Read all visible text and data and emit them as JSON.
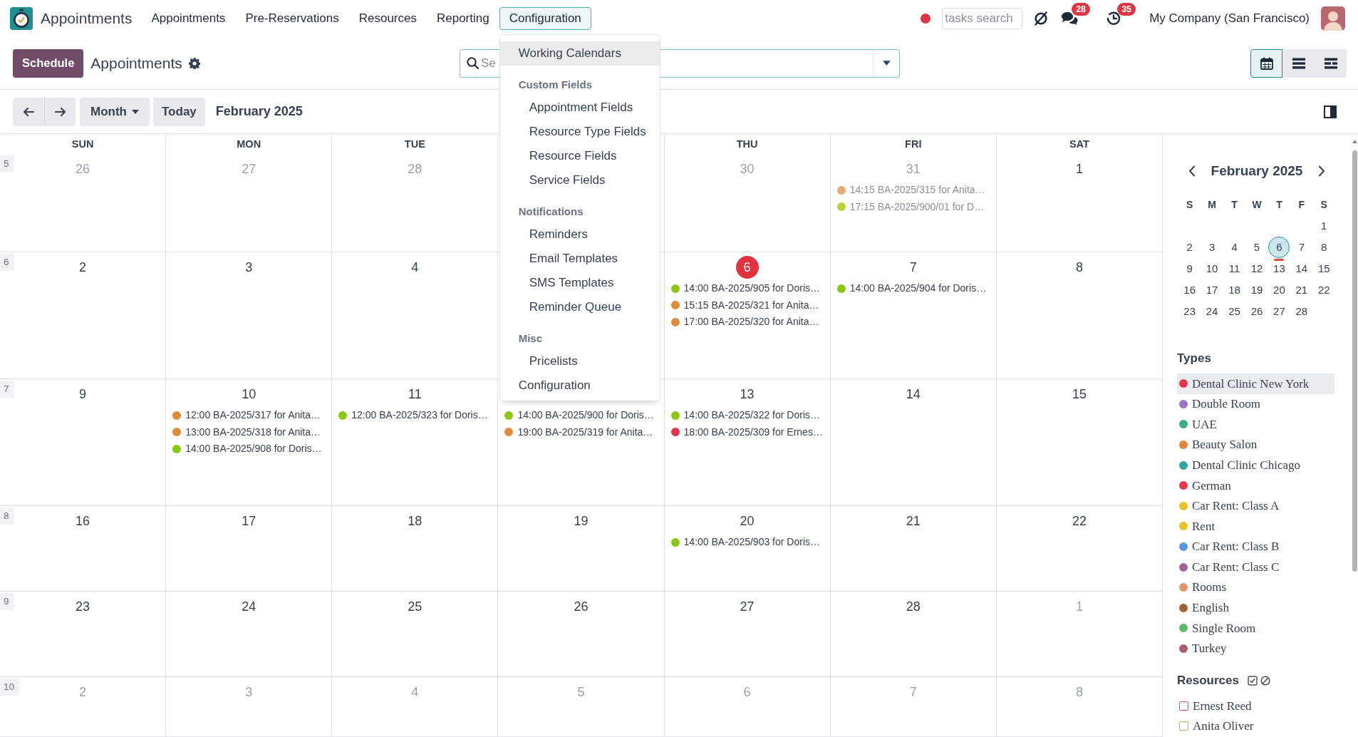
{
  "navbar": {
    "brand": "Appointments",
    "menu": [
      {
        "label": "Appointments",
        "selected": false
      },
      {
        "label": "Pre-Reservations",
        "selected": false
      },
      {
        "label": "Resources",
        "selected": false
      },
      {
        "label": "Reporting",
        "selected": false
      },
      {
        "label": "Configuration",
        "selected": true
      }
    ],
    "tasks_search": {
      "placeholder": "tasks search"
    },
    "messages_badge": "28",
    "activities_badge": "35",
    "company": "My Company (San Francisco)"
  },
  "control_panel": {
    "primary_button": "Schedule",
    "title": "Appointments",
    "search": {
      "placeholder": "Se"
    },
    "views": [
      {
        "kind": "calendar",
        "selected": true
      },
      {
        "kind": "list",
        "selected": false
      },
      {
        "kind": "gantt",
        "selected": false
      }
    ]
  },
  "toolbar": {
    "scale": "Month",
    "today_button": "Today",
    "period": "February 2025"
  },
  "configuration_menu": {
    "items": [
      {
        "kind": "item",
        "label": "Working Calendars",
        "highlighted": true
      },
      {
        "kind": "header",
        "label": "Custom Fields",
        "highlighted": false
      },
      {
        "kind": "subitem",
        "label": "Appointment Fields",
        "highlighted": false
      },
      {
        "kind": "subitem",
        "label": "Resource Type Fields",
        "highlighted": false
      },
      {
        "kind": "subitem",
        "label": "Resource Fields",
        "highlighted": false
      },
      {
        "kind": "subitem",
        "label": "Service Fields",
        "highlighted": false
      },
      {
        "kind": "header",
        "label": "Notifications",
        "highlighted": false
      },
      {
        "kind": "subitem",
        "label": "Reminders",
        "highlighted": false
      },
      {
        "kind": "subitem",
        "label": "Email Templates",
        "highlighted": false
      },
      {
        "kind": "subitem",
        "label": "SMS Templates",
        "highlighted": false
      },
      {
        "kind": "subitem",
        "label": "Reminder Queue",
        "highlighted": false
      },
      {
        "kind": "header",
        "label": "Misc",
        "highlighted": false
      },
      {
        "kind": "subitem",
        "label": "Pricelists",
        "highlighted": false
      },
      {
        "kind": "item",
        "label": "Configuration",
        "highlighted": false
      }
    ]
  },
  "calendar": {
    "weekdays": {
      "sun": "SUN",
      "mon": "MON",
      "tue": "TUE",
      "thu": "THU",
      "fri": "FRI",
      "sat": "SAT"
    },
    "weeks": [
      {
        "number": "5",
        "days": {
          "sun": {
            "date": "26",
            "muted": true,
            "today": false
          },
          "mon": {
            "date": "27",
            "muted": true,
            "today": false
          },
          "tue": {
            "date": "28",
            "muted": true,
            "today": false
          },
          "thu": {
            "date": "30",
            "muted": true,
            "today": false
          },
          "fri": {
            "date": "31",
            "muted": true,
            "today": false,
            "events": [
              {
                "text": "14:15 BA-2025/315 for Anita…",
                "color": "#e9a97b"
              },
              {
                "text": "17:15 BA-2025/900/01 for D…",
                "color": "#b3d43a"
              }
            ]
          },
          "sat": {
            "date": "1",
            "muted": false,
            "today": false
          }
        }
      },
      {
        "number": "6",
        "days": {
          "sun": {
            "date": "2",
            "muted": false,
            "today": false
          },
          "mon": {
            "date": "3",
            "muted": false,
            "today": false
          },
          "tue": {
            "date": "4",
            "muted": false,
            "today": false
          },
          "thu": {
            "date": "6",
            "muted": false,
            "today": true,
            "events": [
              {
                "text": "14:00 BA-2025/905 for Doris…",
                "color": "#8bc716"
              },
              {
                "text": "15:15 BA-2025/321 for Anita…",
                "color": "#e08a3b"
              },
              {
                "text": "17:00 BA-2025/320 for Anita…",
                "color": "#e08a3b"
              }
            ]
          },
          "fri": {
            "date": "7",
            "muted": false,
            "today": false,
            "events": [
              {
                "text": "14:00 BA-2025/904 for Doris…",
                "color": "#8bc716"
              }
            ]
          },
          "sat": {
            "date": "8",
            "muted": false,
            "today": false
          }
        }
      },
      {
        "number": "7",
        "days": {
          "sun": {
            "date": "9",
            "muted": false,
            "today": false
          },
          "mon": {
            "date": "10",
            "muted": false,
            "today": false,
            "events": [
              {
                "text": "12:00 BA-2025/317 for Anita…",
                "color": "#e08a3b"
              },
              {
                "text": "13:00 BA-2025/318 for Anita…",
                "color": "#e08a3b"
              },
              {
                "text": "14:00 BA-2025/908 for Doris…",
                "color": "#8bc716"
              }
            ]
          },
          "tue": {
            "date": "11",
            "muted": false,
            "today": false,
            "events": [
              {
                "text": "12:00 BA-2025/323 for Doris…",
                "color": "#8bc716"
              }
            ]
          },
          "wed": {
            "events": [
              {
                "text": "14:00 BA-2025/900 for Doris…",
                "color": "#8bc716"
              },
              {
                "text": "19:00 BA-2025/319 for Anita…",
                "color": "#e08a3b"
              }
            ]
          },
          "thu": {
            "date": "13",
            "muted": false,
            "today": false,
            "events": [
              {
                "text": "14:00 BA-2025/322 for Doris…",
                "color": "#8bc716"
              },
              {
                "text": "18:00 BA-2025/309 for Ernes…",
                "color": "#e03448"
              }
            ]
          },
          "fri": {
            "date": "14",
            "muted": false,
            "today": false
          },
          "sat": {
            "date": "15",
            "muted": false,
            "today": false
          }
        }
      },
      {
        "number": "8",
        "days": {
          "sun": {
            "date": "16",
            "muted": false,
            "today": false
          },
          "mon": {
            "date": "17",
            "muted": false,
            "today": false
          },
          "tue": {
            "date": "18",
            "muted": false,
            "today": false
          },
          "wed": {
            "date": "19",
            "muted": false,
            "today": false
          },
          "thu": {
            "date": "20",
            "muted": false,
            "today": false,
            "events": [
              {
                "text": "14:00 BA-2025/903 for Doris…",
                "color": "#8bc716"
              }
            ]
          },
          "fri": {
            "date": "21",
            "muted": false,
            "today": false
          },
          "sat": {
            "date": "22",
            "muted": false,
            "today": false
          }
        }
      },
      {
        "number": "9",
        "days": {
          "sun": {
            "date": "23",
            "muted": false,
            "today": false
          },
          "mon": {
            "date": "24",
            "muted": false,
            "today": false
          },
          "tue": {
            "date": "25",
            "muted": false,
            "today": false
          },
          "wed": {
            "date": "26",
            "muted": false,
            "today": false
          },
          "thu": {
            "date": "27",
            "muted": false,
            "today": false
          },
          "fri": {
            "date": "28",
            "muted": false,
            "today": false
          },
          "sat": {
            "date": "1",
            "muted": true,
            "today": false
          }
        }
      },
      {
        "number": "10",
        "days": {
          "sun": {
            "date": "2",
            "muted": true,
            "today": false
          },
          "mon": {
            "date": "3",
            "muted": true,
            "today": false
          },
          "tue": {
            "date": "4",
            "muted": true,
            "today": false
          },
          "wed": {
            "date": "5",
            "muted": true,
            "today": false
          },
          "thu": {
            "date": "6",
            "muted": true,
            "today": false
          },
          "fri": {
            "date": "7",
            "muted": true,
            "today": false
          },
          "sat": {
            "date": "8",
            "muted": true,
            "today": false
          }
        }
      }
    ]
  },
  "sidebar": {
    "mini_calendar": {
      "title": "February 2025",
      "weekdays": [
        "S",
        "M",
        "T",
        "W",
        "T",
        "F",
        "S"
      ],
      "weeks": [
        {
          "sat": {
            "day": "1",
            "today": false
          }
        },
        {
          "sun": {
            "day": "2",
            "today": false
          },
          "mon": {
            "day": "3",
            "today": false
          },
          "tue": {
            "day": "4",
            "today": false
          },
          "wed": {
            "day": "5",
            "today": false
          },
          "thu": {
            "day": "6",
            "today": true
          },
          "fri": {
            "day": "7",
            "today": false
          },
          "sat": {
            "day": "8",
            "today": false
          }
        },
        {
          "sun": {
            "day": "9",
            "today": false
          },
          "mon": {
            "day": "10",
            "today": false
          },
          "tue": {
            "day": "11",
            "today": false
          },
          "wed": {
            "day": "12",
            "today": false
          },
          "thu": {
            "day": "13",
            "today": false
          },
          "fri": {
            "day": "14",
            "today": false
          },
          "sat": {
            "day": "15",
            "today": false
          }
        },
        {
          "sun": {
            "day": "16",
            "today": false
          },
          "mon": {
            "day": "17",
            "today": false
          },
          "tue": {
            "day": "18",
            "today": false
          },
          "wed": {
            "day": "19",
            "today": false
          },
          "thu": {
            "day": "20",
            "today": false
          },
          "fri": {
            "day": "21",
            "today": false
          },
          "sat": {
            "day": "22",
            "today": false
          }
        },
        {
          "sun": {
            "day": "23",
            "today": false
          },
          "mon": {
            "day": "24",
            "today": false
          },
          "tue": {
            "day": "25",
            "today": false
          },
          "wed": {
            "day": "26",
            "today": false
          },
          "thu": {
            "day": "27",
            "today": false
          },
          "fri": {
            "day": "28",
            "today": false
          }
        }
      ]
    },
    "types": {
      "title": "Types",
      "items": [
        {
          "label": "Dental Clinic New York",
          "color": "#e2394e",
          "highlighted": true
        },
        {
          "label": "Double Room",
          "color": "#9a78c0",
          "highlighted": false
        },
        {
          "label": "UAE",
          "color": "#3aad86",
          "highlighted": false
        },
        {
          "label": "Beauty Salon",
          "color": "#e0853a",
          "highlighted": false
        },
        {
          "label": "Dental Clinic Chicago",
          "color": "#2fa6a0",
          "highlighted": false
        },
        {
          "label": "German",
          "color": "#e2394e",
          "highlighted": false
        },
        {
          "label": "Car Rent: Class A",
          "color": "#e5c22a",
          "highlighted": false
        },
        {
          "label": "Rent",
          "color": "#e5c22a",
          "highlighted": false
        },
        {
          "label": "Car Rent: Class B",
          "color": "#5499dd",
          "highlighted": false
        },
        {
          "label": "Car Rent: Class C",
          "color": "#a06a90",
          "highlighted": false
        },
        {
          "label": "Rooms",
          "color": "#e0956a",
          "highlighted": false
        },
        {
          "label": "English",
          "color": "#a0643a",
          "highlighted": false
        },
        {
          "label": "Single Room",
          "color": "#5bbd6b",
          "highlighted": false
        },
        {
          "label": "Turkey",
          "color": "#a8606e",
          "highlighted": false
        }
      ]
    },
    "resources": {
      "title": "Resources",
      "items": [
        {
          "label": "Ernest Reed",
          "color": "#e04f4f",
          "checked": false
        },
        {
          "label": "Anita Oliver",
          "color": "#e3994f",
          "checked": false
        }
      ]
    }
  }
}
